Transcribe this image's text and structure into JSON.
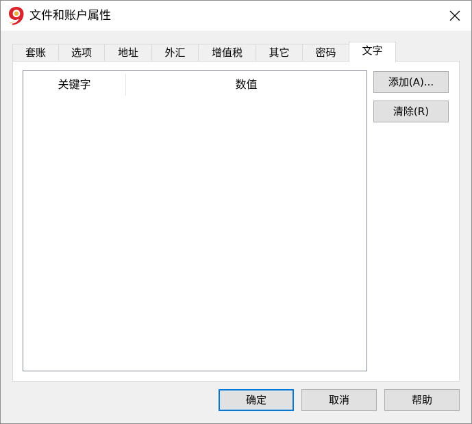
{
  "window": {
    "title": "文件和账户属性",
    "app_icon_glyph": "9",
    "close_glyph": "✕"
  },
  "tabs": [
    {
      "label": "套账",
      "active": false
    },
    {
      "label": "选项",
      "active": false
    },
    {
      "label": "地址",
      "active": false
    },
    {
      "label": "外汇",
      "active": false
    },
    {
      "label": "增值税",
      "active": false
    },
    {
      "label": "其它",
      "active": false
    },
    {
      "label": "密码",
      "active": false
    },
    {
      "label": "文字",
      "active": true
    }
  ],
  "list": {
    "columns": [
      {
        "label": "关键字"
      },
      {
        "label": "数值"
      }
    ],
    "rows": []
  },
  "side_buttons": {
    "add_label": "添加(A)...",
    "clear_label": "清除(R)"
  },
  "footer_buttons": {
    "ok_label": "确定",
    "cancel_label": "取消",
    "help_label": "帮助"
  },
  "colors": {
    "accent": "#0078d7",
    "icon_red": "#d9232d",
    "icon_gold": "#e8a21c"
  }
}
